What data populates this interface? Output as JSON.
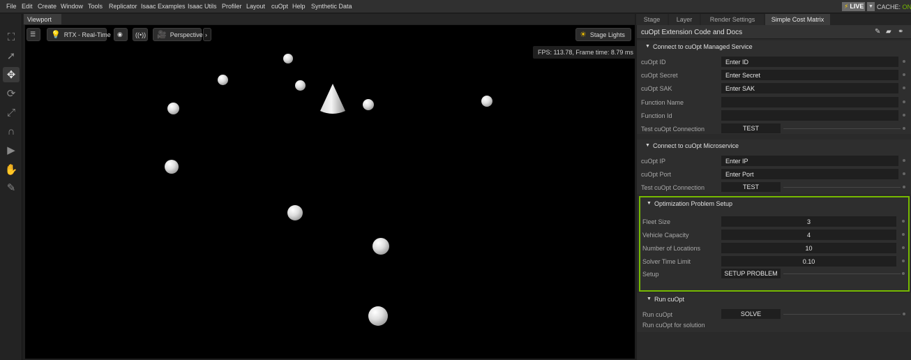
{
  "menu": [
    "File",
    "Edit",
    "Create",
    "Window",
    "Tools",
    "Replicator",
    "Isaac Examples",
    "Isaac Utils",
    "Profiler",
    "Layout",
    "cuOpt",
    "Help",
    "Synthetic Data"
  ],
  "status": {
    "live_label": "LIVE",
    "cache_label": "CACHE:",
    "cache_value": "ON",
    "accent": "#76b900"
  },
  "toolbar_icons": [
    "grid-icon",
    "select-arrow-icon",
    "move-icon",
    "rotate-icon",
    "scale-icon",
    "snap-magnet-icon",
    "play-icon",
    "physics-icon",
    "paint-brush-icon"
  ],
  "viewport": {
    "tab_label": "Viewport",
    "renderer_label": "RTX - Real-Time",
    "camera_label": "Perspective",
    "lights_label": "Stage Lights",
    "fps_text": "FPS: 113.78, Frame time: 8.79 ms"
  },
  "panel_tabs": [
    "Stage",
    "Layer",
    "Render Settings",
    "Simple Cost Matrix"
  ],
  "panel": {
    "title": "cuOpt Extension Code and Docs",
    "managed": {
      "title": "Connect to cuOpt Managed Service",
      "id_label": "cuOpt ID",
      "id_value": "Enter ID",
      "secret_label": "cuOpt Secret",
      "secret_value": "Enter Secret",
      "sak_label": "cuOpt SAK",
      "sak_value": "Enter SAK",
      "fn_name_label": "Function Name",
      "fn_name_value": "",
      "fn_id_label": "Function Id",
      "fn_id_value": "",
      "test_label": "Test cuOpt Connection",
      "test_button": "TEST"
    },
    "micro": {
      "title": "Connect to cuOpt Microservice",
      "ip_label": "cuOpt IP",
      "ip_value": "Enter IP",
      "port_label": "cuOpt Port",
      "port_value": "Enter Port",
      "test_label": "Test cuOpt Connection",
      "test_button": "TEST"
    },
    "opt": {
      "title": "Optimization Problem Setup",
      "fleet_label": "Fleet Size",
      "fleet_value": "3",
      "capacity_label": "Vehicle Capacity",
      "capacity_value": "4",
      "locations_label": "Number of Locations",
      "locations_value": "10",
      "time_label": "Solver Time Limit",
      "time_value": "0.10",
      "setup_label": "Setup",
      "setup_button": "SETUP PROBLEM"
    },
    "run": {
      "title": "Run cuOpt",
      "run_label": "Run cuOpt",
      "solve_button": "SOLVE",
      "hint": "Run cuOpt for solution"
    }
  }
}
